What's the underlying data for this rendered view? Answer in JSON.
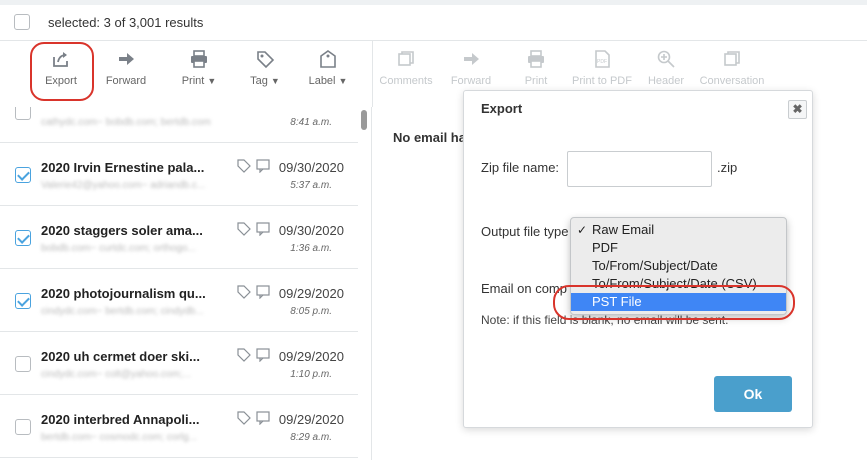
{
  "selection": {
    "text": "selected: 3 of 3,001 results"
  },
  "toolbar": {
    "left": [
      {
        "label": "Export",
        "icon": "export-icon"
      },
      {
        "label": "Forward",
        "icon": "forward-arrow-icon"
      },
      {
        "label": "Print",
        "icon": "printer-icon"
      },
      {
        "label": "Tag",
        "icon": "tag-icon"
      },
      {
        "label": "Label",
        "icon": "label-tag-icon"
      }
    ],
    "right": [
      {
        "label": "Comments",
        "icon": "comments-icon"
      },
      {
        "label": "Forward",
        "icon": "forward-arrow-icon"
      },
      {
        "label": "Print",
        "icon": "printer-icon"
      },
      {
        "label": "Print to PDF",
        "icon": "pdf-icon"
      },
      {
        "label": "Header",
        "icon": "zoom-in-icon"
      },
      {
        "label": "Conversation",
        "icon": "conversation-icon"
      }
    ]
  },
  "emails": [
    {
      "subject": "",
      "date": "",
      "time": "8:41 a.m.",
      "from": "cathydc.com~ bobdb.com; bertdb.com",
      "checked": false
    },
    {
      "subject": "2020 Irvin Ernestine pala...",
      "date": "09/30/2020",
      "time": "5:37 a.m.",
      "from": "Valerie42@yahoo.com~ adriandb.c...",
      "checked": true
    },
    {
      "subject": "2020 staggers soler ama...",
      "date": "09/30/2020",
      "time": "1:36 a.m.",
      "from": "bobdb.com~ curtdc.com; orthogo...",
      "checked": true
    },
    {
      "subject": "2020 photojournalism qu...",
      "date": "09/29/2020",
      "time": "8:05 p.m.",
      "from": "cindydc.com~ bertdb.com; cindydb...",
      "checked": true
    },
    {
      "subject": "2020 uh cermet doer ski...",
      "date": "09/29/2020",
      "time": "1:10 p.m.",
      "from": "cindydc.com~ colt@yahoo.com;...",
      "checked": false
    },
    {
      "subject": "2020 interbred Annapoli...",
      "date": "09/29/2020",
      "time": "8:29 a.m.",
      "from": "bertdb.com~ cosmodc.com; corlg...",
      "checked": false
    }
  ],
  "preview": {
    "text": "No email ha"
  },
  "dialog": {
    "title": "Export",
    "close": "✖",
    "zip_label": "Zip file name:",
    "zip_value": "",
    "zip_suffix": ".zip",
    "output_label": "Output file type",
    "email_label": "Email on comp",
    "note": "Note: if this field is blank, no email will be sent.",
    "ok": "Ok"
  },
  "dropdown": {
    "options": [
      "Raw Email",
      "PDF",
      "To/From/Subject/Date",
      "To/From/Subject/Date (CSV)",
      "PST File"
    ],
    "checked_index": 0,
    "highlighted_index": 4
  },
  "colors": {
    "accent": "#4a9fcc",
    "highlight": "#3f86f5",
    "annotation": "#d9342b",
    "checkbox": "#4aa3df"
  }
}
